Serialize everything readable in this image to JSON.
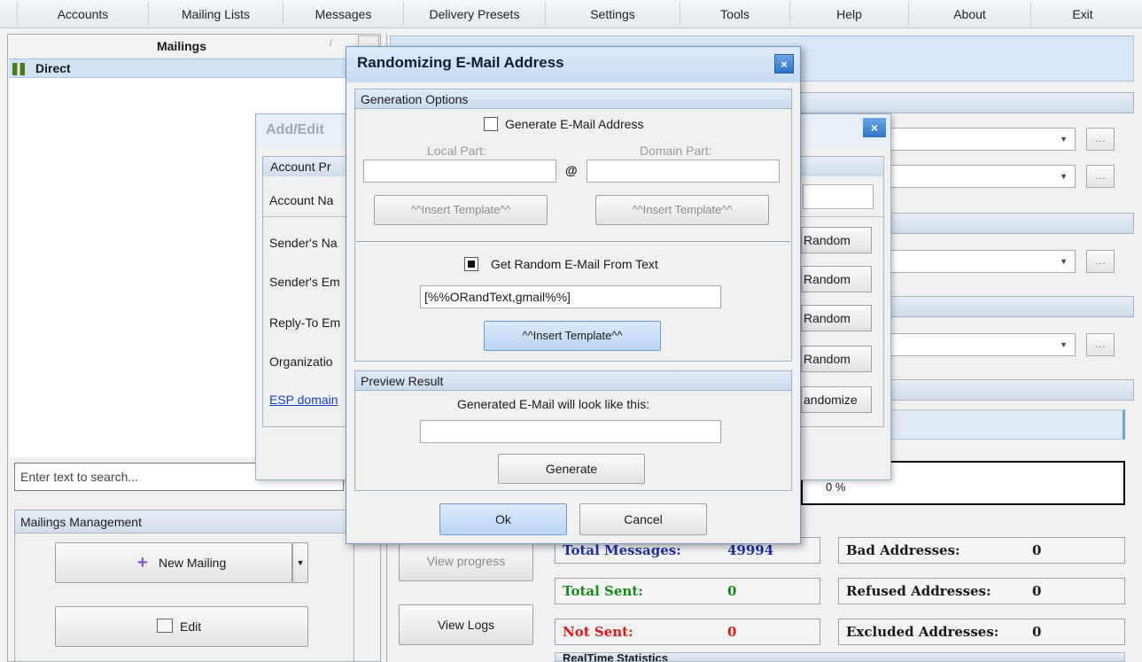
{
  "menubar": {
    "items": [
      "Accounts",
      "Mailing Lists",
      "Messages",
      "Delivery Presets",
      "Settings",
      "Tools",
      "Help",
      "About",
      "Exit"
    ]
  },
  "left": {
    "header": "Mailings",
    "sort_glyph": "/",
    "group": "Direct",
    "search_placeholder": "Enter text to search...",
    "mm_header": "Mailings Management",
    "new_mailing": "New Mailing",
    "edit": "Edit"
  },
  "right": {
    "view_progress": "View progress",
    "view_logs": "View Logs",
    "progress_value": "0 %",
    "stats": {
      "total_messages_label": "Total Messages:",
      "total_messages": "49994",
      "total_sent_label": "Total Sent:",
      "total_sent": "0",
      "not_sent_label": "Not Sent:",
      "not_sent": "0",
      "bad_label": "Bad Addresses:",
      "bad": "0",
      "refused_label": "Refused Addresses:",
      "refused": "0",
      "excluded_label": "Excluded Addresses:",
      "excluded": "0"
    },
    "realtime_label": "RealTime Statistics"
  },
  "addedit": {
    "title": "Add/Edit",
    "group": "Account Pr",
    "account_name": "Account Na",
    "senders_name": "Sender's Na",
    "senders_email": "Sender's Em",
    "reply_to": "Reply-To Em",
    "organization": "Organizatio",
    "esp_link": "ESP domain",
    "random": "Random",
    "randomize": "andomize"
  },
  "rand": {
    "title": "Randomizing E-Mail Address",
    "close": "×",
    "gen_options": "Generation Options",
    "generate_email": "Generate E-Mail Address",
    "generate_checked": false,
    "local_part": "Local Part:",
    "domain_part": "Domain Part:",
    "at": "@",
    "insert_template": "^^Insert Template^^",
    "get_random_text": "Get Random E-Mail From Text",
    "get_random_checked": true,
    "text_value": "[%%ORandText,gmail%%]",
    "preview_result": "Preview Result",
    "preview_label": "Generated E-Mail will look like this:",
    "preview_value": "",
    "generate": "Generate",
    "ok": "Ok",
    "cancel": "Cancel"
  }
}
